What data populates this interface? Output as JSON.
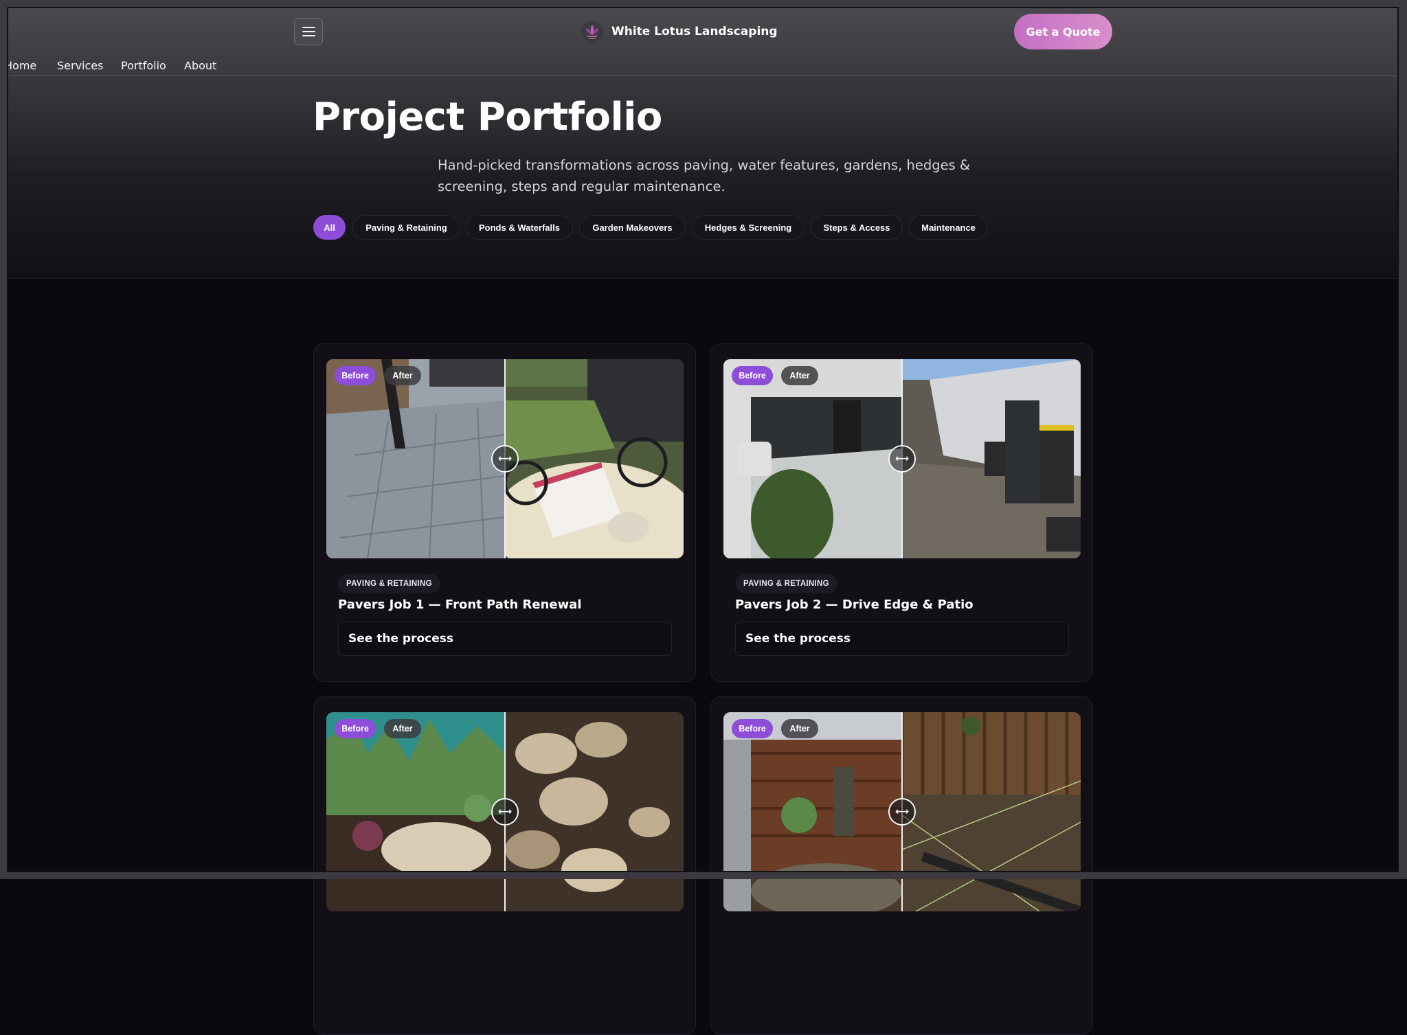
{
  "header": {
    "brand_name": "White Lotus Landscaping",
    "quote_label": "Get a Quote",
    "nav": [
      "Home",
      "Services",
      "Portfolio",
      "About"
    ]
  },
  "hero": {
    "title": "Project Portfolio",
    "subtitle": "Hand-picked transformations across paving, water features, gardens, hedges & screening, steps and regular maintenance."
  },
  "filters": [
    {
      "label": "All",
      "active": true
    },
    {
      "label": "Paving & Retaining",
      "active": false
    },
    {
      "label": "Ponds & Waterfalls",
      "active": false
    },
    {
      "label": "Garden Makeovers",
      "active": false
    },
    {
      "label": "Hedges & Screening",
      "active": false
    },
    {
      "label": "Steps & Access",
      "active": false
    },
    {
      "label": "Maintenance",
      "active": false
    }
  ],
  "labels": {
    "before": "Before",
    "after": "After",
    "process": "See the process"
  },
  "projects": [
    {
      "category": "PAVING & RETAINING",
      "title": "Pavers Job 1 — Front Path Renewal"
    },
    {
      "category": "PAVING & RETAINING",
      "title": "Pavers Job 2 — Drive Edge & Patio"
    },
    {
      "category": "",
      "title": ""
    },
    {
      "category": "",
      "title": ""
    }
  ],
  "colors": {
    "accent": "#8d4dd8",
    "quote_gradient_start": "#c56fc3",
    "quote_gradient_end": "#d88fca",
    "background": "#0b090e"
  },
  "icons": {
    "menu": "hamburger-icon",
    "logo": "lotus-logo-icon",
    "compare_handle": "drag-handle-icon"
  }
}
